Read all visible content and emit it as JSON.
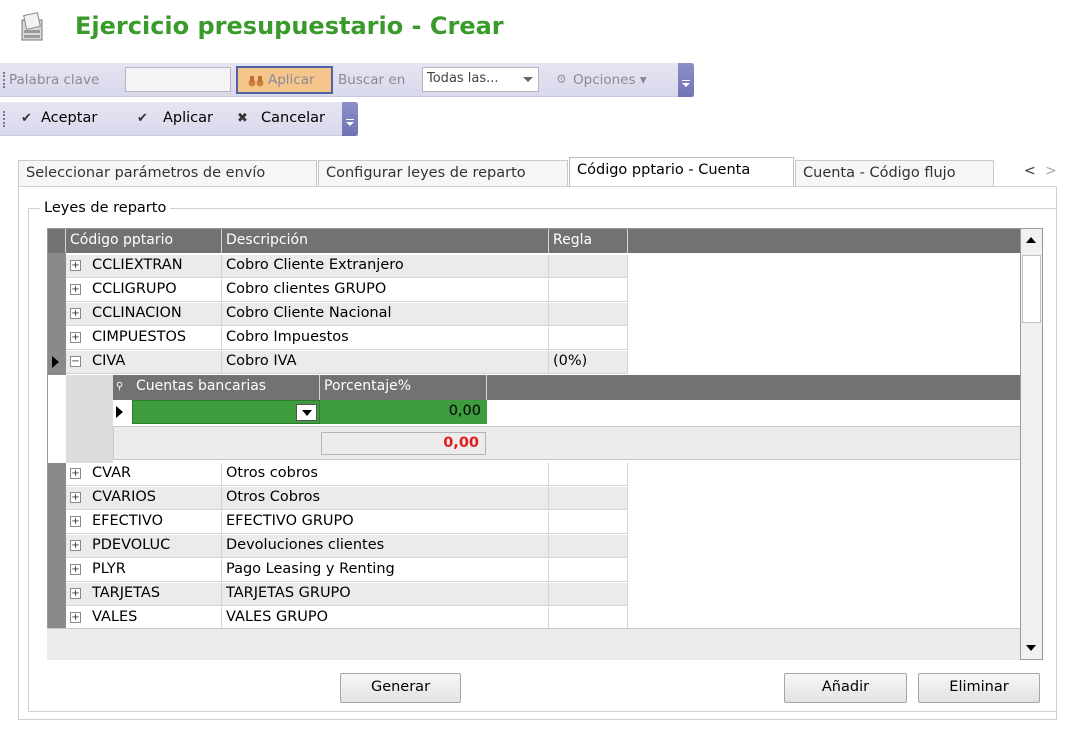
{
  "title": "Ejercicio presupuestario - Crear",
  "toolbar1": {
    "keyword_label": "Palabra clave",
    "keyword_value": "",
    "apply_label": "Aplicar",
    "search_in_label": "Buscar en",
    "search_in_value": "Todas las...",
    "options_label": "Opciones"
  },
  "toolbar2": {
    "accept_label": "Aceptar",
    "apply_label": "Aplicar",
    "cancel_label": "Cancelar"
  },
  "tabs": [
    {
      "label": "Seleccionar parámetros de envío"
    },
    {
      "label": "Configurar leyes de reparto"
    },
    {
      "label": "Código pptario - Cuenta"
    },
    {
      "label": "Cuenta - Código flujo"
    }
  ],
  "groupbox_label": "Leyes de reparto",
  "grid": {
    "columns": [
      "Código pptario",
      "Descripción",
      "Regla"
    ],
    "rows_top": [
      {
        "code": "CCLIEXTRAN",
        "desc": "Cobro Cliente Extranjero",
        "rule": ""
      },
      {
        "code": "CCLIGRUPO",
        "desc": "Cobro clientes GRUPO",
        "rule": ""
      },
      {
        "code": "CCLINACION",
        "desc": "Cobro Cliente Nacional",
        "rule": ""
      },
      {
        "code": "CIMPUESTOS",
        "desc": "Cobro Impuestos",
        "rule": ""
      },
      {
        "code": "CIVA",
        "desc": "Cobro IVA",
        "rule": "(0%)"
      }
    ],
    "detail": {
      "columns": [
        "Cuentas bancarias",
        "Porcentaje%"
      ],
      "row_account": "",
      "row_percent": "0,00",
      "total": "0,00"
    },
    "rows_bottom": [
      {
        "code": "CVAR",
        "desc": "Otros cobros",
        "rule": ""
      },
      {
        "code": "CVARIOS",
        "desc": "Otros Cobros",
        "rule": ""
      },
      {
        "code": "EFECTIVO",
        "desc": "EFECTIVO GRUPO",
        "rule": ""
      },
      {
        "code": "PDEVOLUC",
        "desc": "Devoluciones clientes",
        "rule": ""
      },
      {
        "code": "PLYR",
        "desc": "Pago Leasing y Renting",
        "rule": ""
      },
      {
        "code": "TARJETAS",
        "desc": "TARJETAS GRUPO",
        "rule": ""
      },
      {
        "code": "VALES",
        "desc": "VALES GRUPO",
        "rule": ""
      }
    ]
  },
  "buttons": {
    "generate": "Generar",
    "add": "Añadir",
    "delete": "Eliminar"
  },
  "colors": {
    "title": "#3a9a2b",
    "selected_cell": "#3d9c3d",
    "total_text": "#e11c1c"
  }
}
